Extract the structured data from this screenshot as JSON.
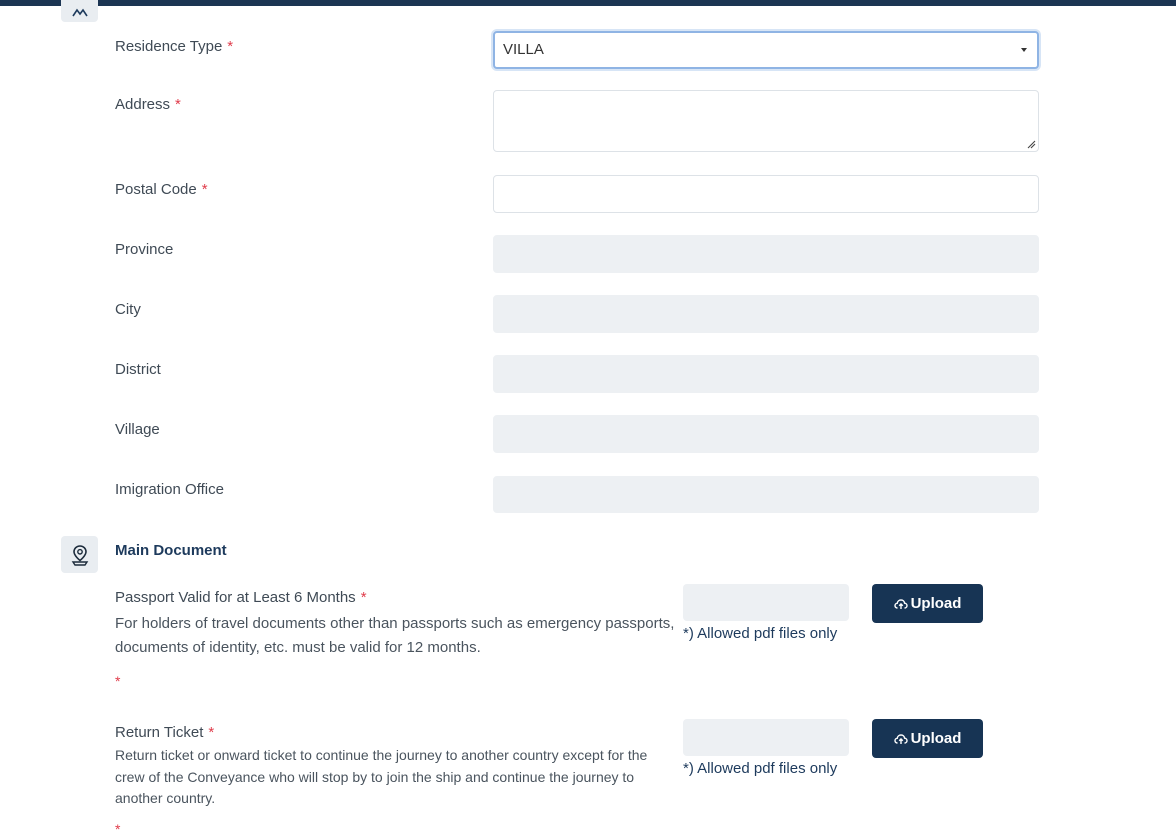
{
  "residence": {
    "residence_type": {
      "label": "Residence Type",
      "value": "VILLA"
    },
    "address": {
      "label": "Address",
      "value": ""
    },
    "postal_code": {
      "label": "Postal Code",
      "value": ""
    },
    "province": {
      "label": "Province",
      "value": ""
    },
    "city": {
      "label": "City",
      "value": ""
    },
    "district": {
      "label": "District",
      "value": ""
    },
    "village": {
      "label": "Village",
      "value": ""
    },
    "immigration_office": {
      "label": "Imigration Office",
      "value": ""
    },
    "required_mark": "*"
  },
  "main_document": {
    "title": "Main Document",
    "icon": "location-pin-icon",
    "items": [
      {
        "title": "Passport Valid for at Least 6 Months",
        "description": "For holders of travel documents other than passports such as emergency passports, documents of identity, etc. must be valid for 12 months.",
        "upload_label": "Upload",
        "hint": "*) Allowed pdf files only"
      },
      {
        "title": "Return Ticket",
        "description": "Return ticket or onward ticket to continue the journey to another country except for the crew of the Conveyance who will stop by to join the ship and continue the journey to another country.",
        "upload_label": "Upload",
        "hint": "*) Allowed pdf files only"
      }
    ]
  },
  "colors": {
    "header": "#1c3553",
    "button": "#173454",
    "required": "#e03b4a",
    "disabled_field": "#edf0f3"
  }
}
